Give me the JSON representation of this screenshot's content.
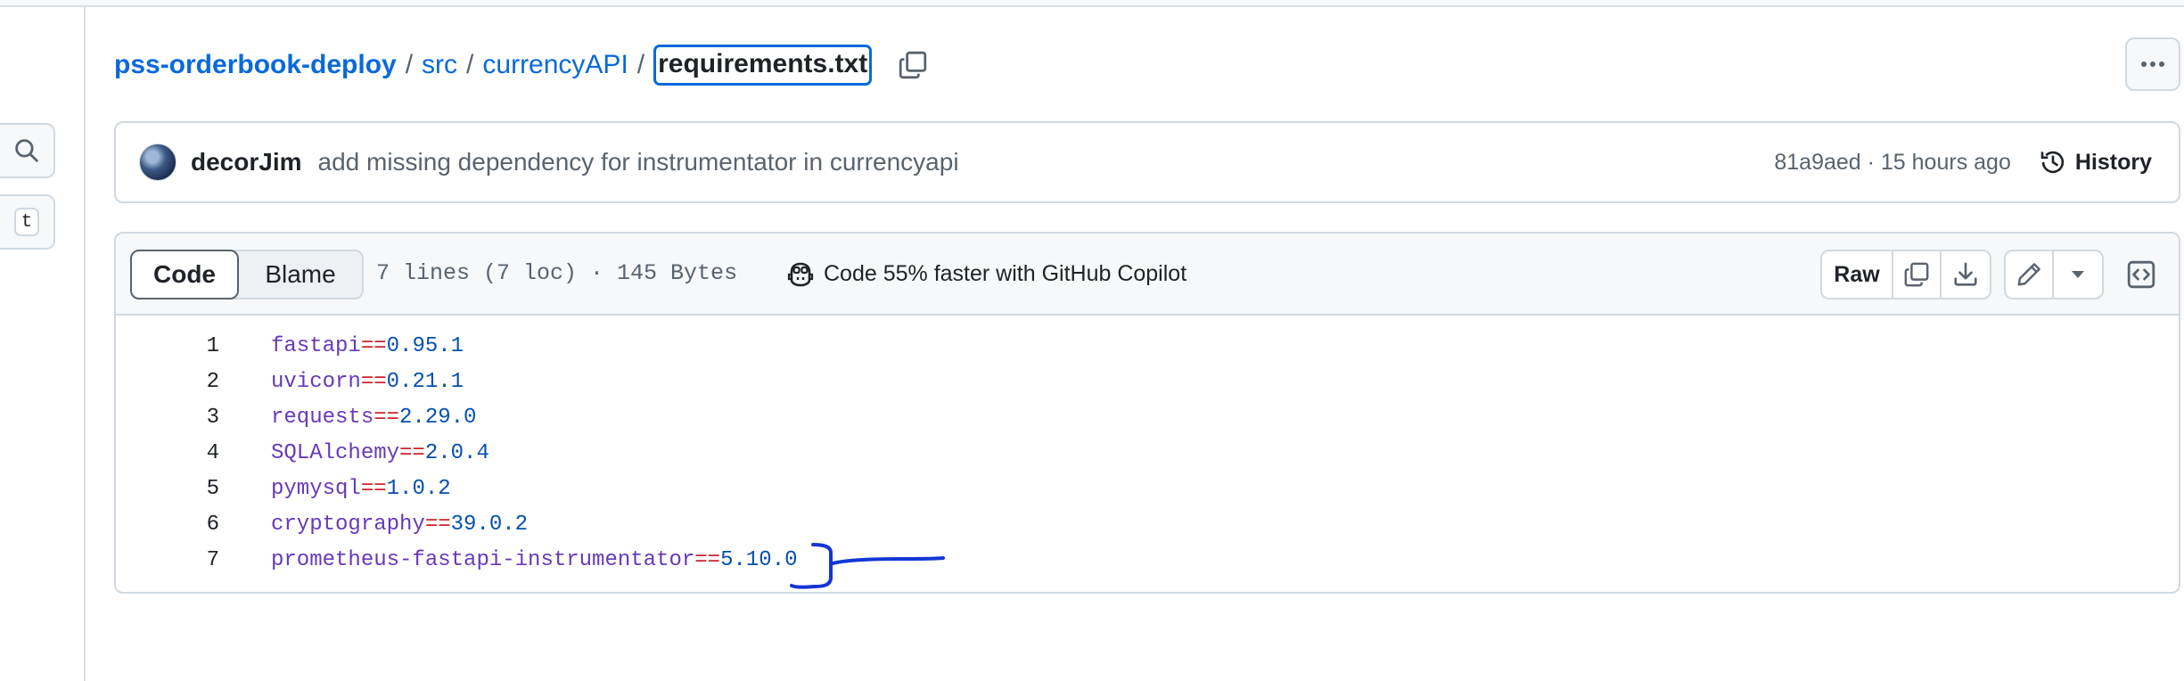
{
  "breadcrumb": {
    "repo": "pss-orderbook-deploy",
    "sep1": "/",
    "dir1": "src",
    "sep2": "/",
    "dir2": "currencyAPI",
    "sep3": "/",
    "file": "requirements.txt"
  },
  "sidebar": {
    "shortcut_key": "t"
  },
  "commit": {
    "author": "decorJim",
    "message": "add missing dependency for instrumentator in currencyapi",
    "sha_time": "81a9aed · 15 hours ago",
    "history_label": "History"
  },
  "file": {
    "tab_code": "Code",
    "tab_blame": "Blame",
    "info": "7 lines (7 loc) · 145 Bytes",
    "copilot": "Code 55% faster with GitHub Copilot",
    "raw_label": "Raw",
    "lines": [
      {
        "num": "1",
        "pkg": "fastapi",
        "op": "==",
        "ver": "0.95.1"
      },
      {
        "num": "2",
        "pkg": "uvicorn",
        "op": "==",
        "ver": "0.21.1"
      },
      {
        "num": "3",
        "pkg": "requests",
        "op": "==",
        "ver": "2.29.0"
      },
      {
        "num": "4",
        "pkg": "SQLAlchemy",
        "op": "==",
        "ver": "2.0.4"
      },
      {
        "num": "5",
        "pkg": "pymysql",
        "op": "==",
        "ver": "1.0.2"
      },
      {
        "num": "6",
        "pkg": "cryptography",
        "op": "==",
        "ver": "39.0.2"
      },
      {
        "num": "7",
        "pkg": "prometheus-fastapi-instrumentator",
        "op": "==",
        "ver": "5.10.0"
      }
    ]
  },
  "colors": {
    "link": "#0969da",
    "annotation": "#1436d6",
    "package": "#6639ba",
    "operator": "#cf222e",
    "version": "#0550ae"
  }
}
